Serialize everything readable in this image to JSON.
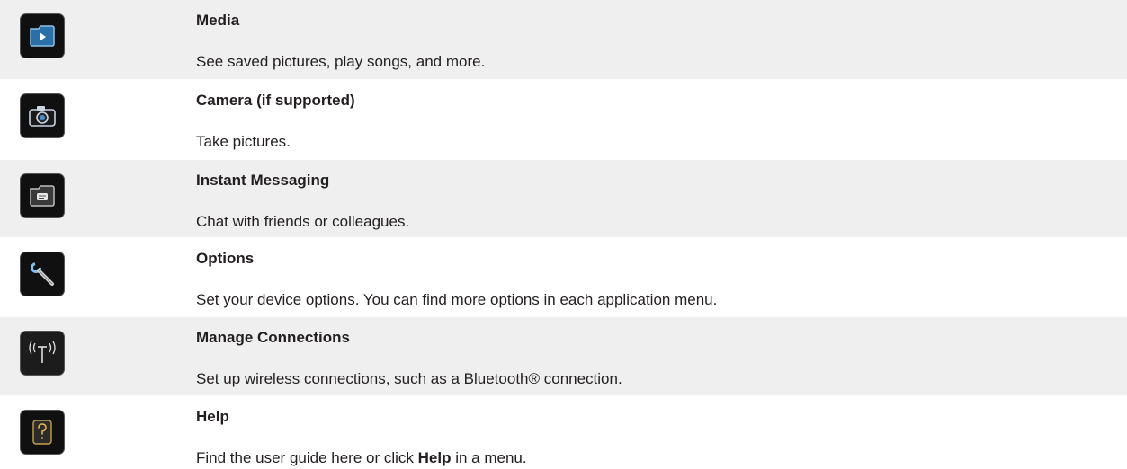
{
  "items": [
    {
      "icon": "media-icon",
      "title": "Media",
      "description": "See saved pictures, play songs, and more."
    },
    {
      "icon": "camera-icon",
      "title": "Camera (if supported)",
      "description": "Take pictures."
    },
    {
      "icon": "instant-messaging-icon",
      "title": "Instant Messaging",
      "description": "Chat with friends or colleagues."
    },
    {
      "icon": "wrench-icon",
      "title": "Options",
      "description": "Set your device options. You can find more options in each application menu."
    },
    {
      "icon": "antenna-icon",
      "title": "Manage Connections",
      "description": "Set up wireless connections, such as a Bluetooth® connection."
    },
    {
      "icon": "help-icon",
      "title": "Help",
      "description_pre": "Find the user guide here or click ",
      "description_bold": "Help",
      "description_post": " in a menu."
    }
  ]
}
